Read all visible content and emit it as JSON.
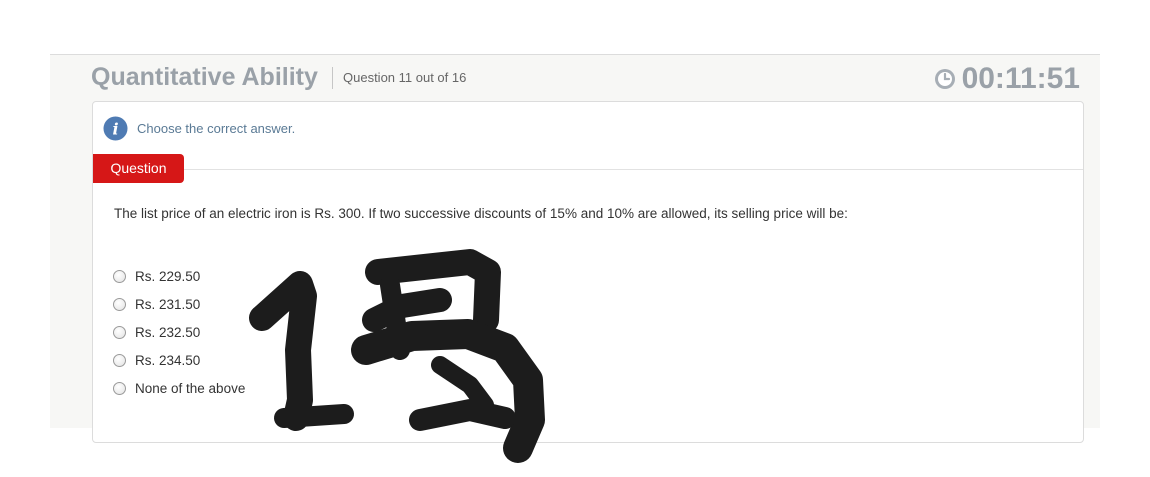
{
  "header": {
    "section_title": "Quantitative Ability",
    "question_counter": "Question 11 out of 16",
    "timer": "00:11:51",
    "timer_icon": "clock-icon"
  },
  "instruction": {
    "icon": "info-icon",
    "text": "Choose the correct answer."
  },
  "question": {
    "tab_label": "Question",
    "text": "The list price of an electric iron is Rs. 300. If two successive discounts of 15% and 10% are allowed, its selling price will be:",
    "options": [
      "Rs. 229.50",
      "Rs. 231.50",
      "Rs. 232.50",
      "Rs. 234.50",
      "None of the above"
    ]
  },
  "colors": {
    "accent_red": "#d61717",
    "header_grey": "#9aa1a8",
    "info_blue": "#5a7a95"
  }
}
